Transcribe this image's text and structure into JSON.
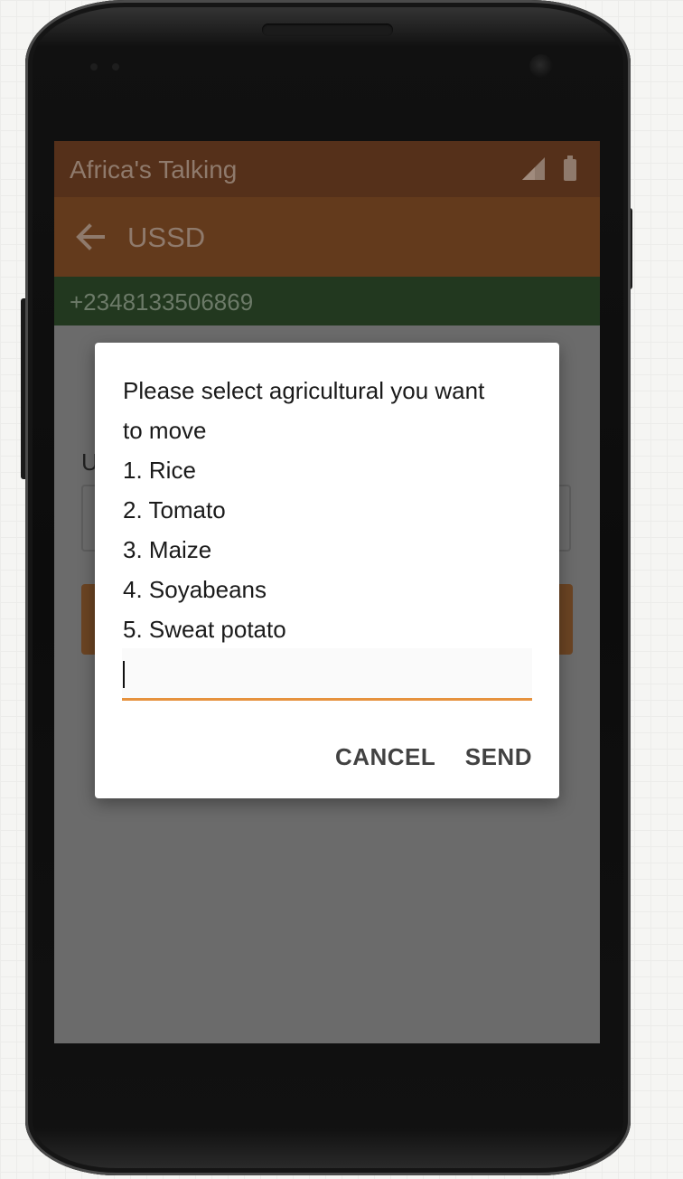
{
  "status_bar": {
    "title": "Africa's Talking",
    "icons": [
      "signal-icon",
      "battery-icon"
    ]
  },
  "app_bar": {
    "back_icon": "arrow-left-icon",
    "title": "USSD"
  },
  "phone_number": "+2348133506869",
  "background_form": {
    "label_partial": "U"
  },
  "dialog": {
    "message_lines": [
      "Please select agricultural you want",
      "to move",
      "1. Rice",
      "2. Tomato",
      "3. Maize",
      "4. Soyabeans",
      "5. Sweat potato"
    ],
    "input_value": "",
    "cancel_label": "CANCEL",
    "send_label": "SEND"
  },
  "colors": {
    "status_bar": "#55301a",
    "app_bar": "#633a1c",
    "phone_bar": "#22381f",
    "accent": "#e6923e",
    "scrim": "#6b6b6b"
  }
}
